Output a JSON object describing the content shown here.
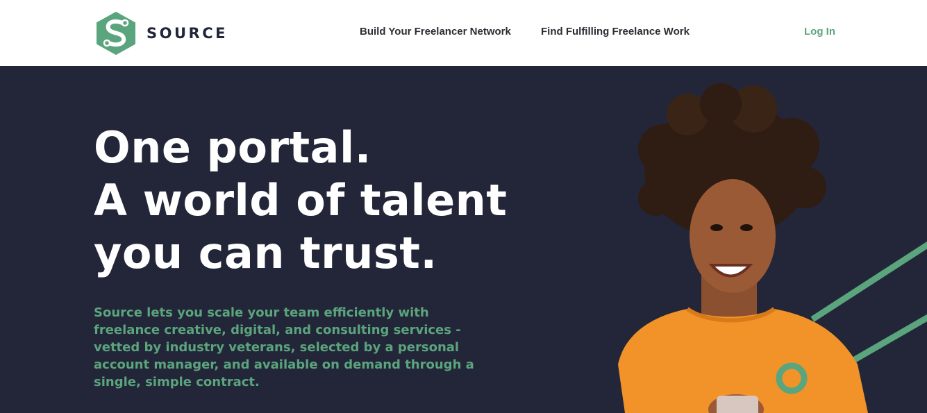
{
  "header": {
    "logo_text": "SOURCE",
    "nav": {
      "network": "Build Your Freelancer Network",
      "work": "Find Fulfilling Freelance Work",
      "login": "Log In"
    }
  },
  "hero": {
    "headline": [
      "One portal.",
      "A world of talent",
      "you can trust."
    ],
    "subtext": "Source lets you scale your team efficiently with freelance creative, digital, and consulting services - vetted by industry veterans, selected by a personal account manager, and available on demand through a single, simple contract."
  },
  "colors": {
    "brand_green": "#5aa57d",
    "hero_background": "#232638",
    "header_background": "#ffffff",
    "sweater_orange": "#f2932a"
  },
  "icons": {
    "logo": "source-hexagon-logo-icon"
  }
}
